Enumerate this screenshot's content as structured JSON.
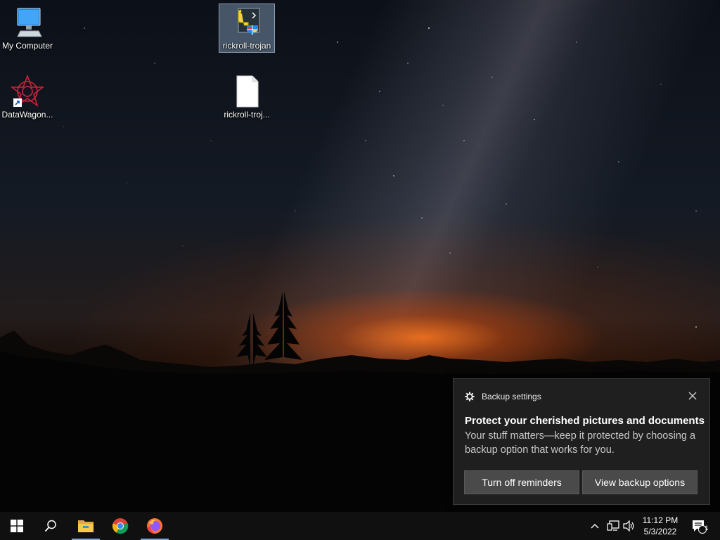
{
  "desktop": {
    "icons": [
      {
        "label": "My Computer"
      },
      {
        "label": "DataWagon..."
      },
      {
        "label": "rickroll-trojan"
      },
      {
        "label": "rickroll-troj..."
      }
    ]
  },
  "toast": {
    "app_name": "Backup settings",
    "title": "Protect your cherished pictures and documents",
    "body": "Your stuff matters—keep it protected by choosing a backup option that works for you.",
    "button_left": "Turn off reminders",
    "button_right": "View backup options",
    "icons": {
      "app": "gear-icon",
      "close": "close-icon"
    }
  },
  "taskbar": {
    "items": [
      "start-icon",
      "search-icon",
      "file-explorer-icon",
      "chrome-icon",
      "firefox-icon"
    ],
    "tray": [
      "chevron-up-icon",
      "network-icon",
      "volume-icon"
    ],
    "clock_time": "11:12 PM",
    "clock_date": "5/3/2022",
    "notification_count": "1"
  },
  "colors": {
    "taskbar_bg": "#101010",
    "toast_bg": "#1f1f1f",
    "button_bg": "#4a4a4a",
    "accent": "#7aa7d8"
  }
}
